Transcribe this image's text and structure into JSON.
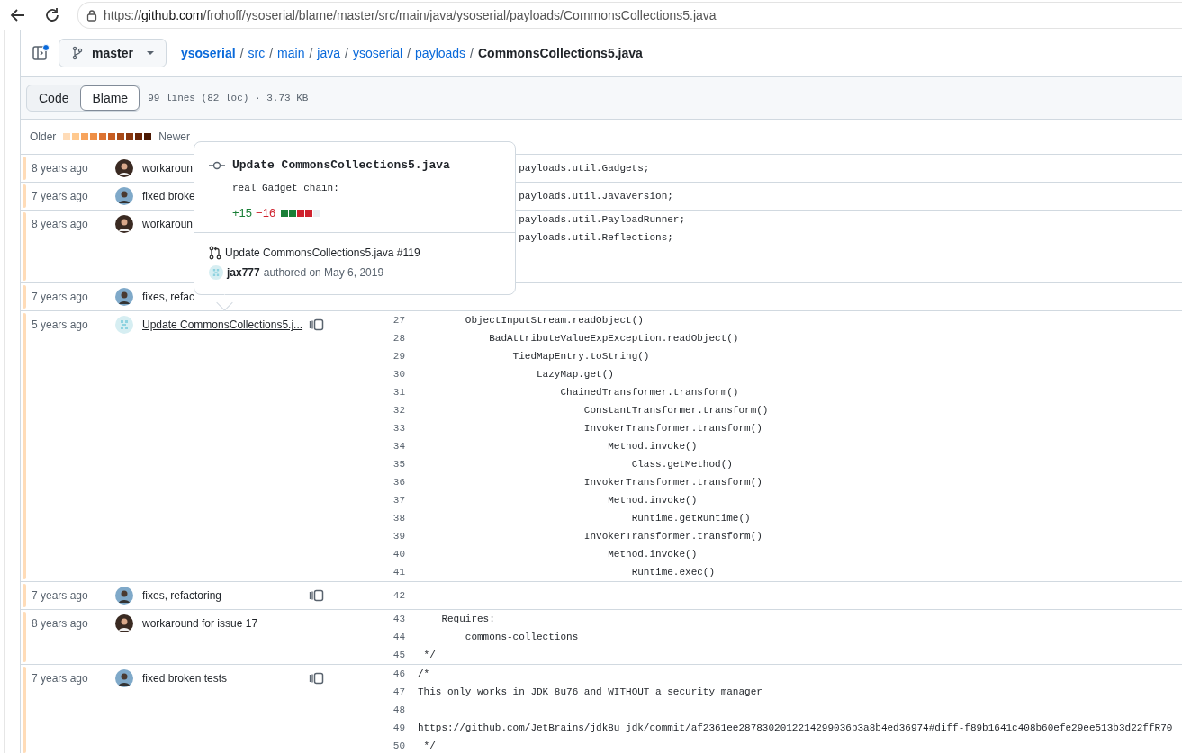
{
  "browser": {
    "url": {
      "scheme": "https://",
      "host": "github.com",
      "path": "/frohoff/ysoserial/blame/master/src/main/java/ysoserial/payloads/CommonsCollections5.java"
    }
  },
  "header": {
    "branch": "master",
    "breadcrumb": [
      {
        "label": "ysoserial",
        "kind": "repo"
      },
      {
        "label": "/",
        "kind": "separator"
      },
      {
        "label": "src",
        "kind": "dir"
      },
      {
        "label": "/",
        "kind": "separator"
      },
      {
        "label": "main",
        "kind": "dir"
      },
      {
        "label": "/",
        "kind": "separator"
      },
      {
        "label": "java",
        "kind": "dir"
      },
      {
        "label": "/",
        "kind": "separator"
      },
      {
        "label": "ysoserial",
        "kind": "dir"
      },
      {
        "label": "/",
        "kind": "separator"
      },
      {
        "label": "payloads",
        "kind": "dir"
      },
      {
        "label": "/",
        "kind": "separator"
      },
      {
        "label": "CommonsCollections5.java",
        "kind": "file"
      }
    ]
  },
  "view_tabs": [
    {
      "label": "Code",
      "selected": false
    },
    {
      "label": "Blame",
      "selected": true
    }
  ],
  "file_info": "99 lines (82 loc) · 3.73 KB",
  "legend": {
    "older": "Older",
    "newer": "Newer",
    "swatches": [
      {
        "color": "#ffdcb8"
      },
      {
        "color": "#ffc98f"
      },
      {
        "color": "#f7a45d"
      },
      {
        "color": "#ef8f45"
      },
      {
        "color": "#dd7331"
      },
      {
        "color": "#c75d22"
      },
      {
        "color": "#a84a18"
      },
      {
        "color": "#8a3810"
      },
      {
        "color": "#6a2608"
      },
      {
        "color": "#4b1903"
      }
    ]
  },
  "blame_rows": [
    {
      "age": "8 years ago",
      "avatar": {
        "kind": "dark-photo"
      },
      "message": "workaroun",
      "link": false,
      "reblame": false,
      "color": "#ffdcb8",
      "lines": [
        {
          "text": "payloads.util.Gadgets;"
        }
      ]
    },
    {
      "age": "7 years ago",
      "avatar": {
        "kind": "light-photo"
      },
      "message": "fixed broke",
      "link": false,
      "reblame": false,
      "color": "#ffdcb8",
      "lines": [
        {
          "text": "payloads.util.JavaVersion;"
        }
      ]
    },
    {
      "age": "8 years ago",
      "avatar": {
        "kind": "dark-photo"
      },
      "message": "workaroun",
      "link": false,
      "reblame": false,
      "color": "#ffdcb8",
      "lines": [
        {
          "kind": "code",
          "text": "payloads.util.PayloadRunner;"
        },
        {
          "kind": "code",
          "text": "payloads.util.Reflections;"
        },
        {
          "kind": "blank"
        },
        {
          "kind": "blank"
        }
      ]
    },
    {
      "age": "7 years ago",
      "avatar": {
        "kind": "light-photo"
      },
      "message": "fixes, refac",
      "link": false,
      "reblame": false,
      "color": "#ffdcb8"
    },
    {
      "age": "5 years ago",
      "avatar": {
        "kind": "identicon"
      },
      "message": "Update CommonsCollections5.j...",
      "link": true,
      "reblame": true,
      "color": "#ffdcb8",
      "lines": [
        {
          "number": "27",
          "text": "        ObjectInputStream.readObject()"
        },
        {
          "number": "28",
          "text": "            BadAttributeValueExpException.readObject()"
        },
        {
          "number": "29",
          "text": "                TiedMapEntry.toString()"
        },
        {
          "number": "30",
          "text": "                    LazyMap.get()"
        },
        {
          "number": "31",
          "text": "                        ChainedTransformer.transform()"
        },
        {
          "number": "32",
          "text": "                            ConstantTransformer.transform()"
        },
        {
          "number": "33",
          "text": "                            InvokerTransformer.transform()"
        },
        {
          "number": "34",
          "text": "                                Method.invoke()"
        },
        {
          "number": "35",
          "text": "                                    Class.getMethod()"
        },
        {
          "number": "36",
          "text": "                            InvokerTransformer.transform()"
        },
        {
          "number": "37",
          "text": "                                Method.invoke()"
        },
        {
          "number": "38",
          "text": "                                    Runtime.getRuntime()"
        },
        {
          "number": "39",
          "text": "                            InvokerTransformer.transform()"
        },
        {
          "number": "40",
          "text": "                                Method.invoke()"
        },
        {
          "number": "41",
          "text": "                                    Runtime.exec()"
        }
      ]
    },
    {
      "age": "7 years ago",
      "avatar": {
        "kind": "light-photo"
      },
      "message": "fixes, refactoring",
      "link": false,
      "reblame": true,
      "color": "#ffdcb8",
      "lines": [
        {
          "number": "42"
        }
      ]
    },
    {
      "age": "8 years ago",
      "avatar": {
        "kind": "dark-photo"
      },
      "message": "workaround for issue 17",
      "link": false,
      "reblame": false,
      "color": "#ffdcb8",
      "lines": [
        {
          "number": "43",
          "text": "    Requires:"
        },
        {
          "number": "44",
          "text": "        commons-collections"
        },
        {
          "number": "45",
          "text": " */"
        }
      ]
    },
    {
      "age": "7 years ago",
      "avatar": {
        "kind": "light-photo"
      },
      "message": "fixed broken tests",
      "link": false,
      "reblame": true,
      "color": "#ffdcb8",
      "lines": [
        {
          "number": "46",
          "text": "/*"
        },
        {
          "number": "47",
          "text": "This only works in JDK 8u76 and WITHOUT a security manager"
        },
        {
          "number": "48"
        },
        {
          "number": "49",
          "text": "https://github.com/JetBrains/jdk8u_jdk/commit/af2361ee2878302012214299036b3a8b4ed36974#diff-f89b1641c408b60efe29ee513b3d22ffR70"
        },
        {
          "number": "50",
          "text": " */"
        }
      ]
    }
  ],
  "popover": {
    "title": "Update CommonsCollections5.java",
    "body": "real Gadget chain:",
    "additions": "+15",
    "deletions": "−16",
    "diffstat": [
      {
        "kind": "added"
      },
      {
        "kind": "added"
      },
      {
        "kind": "deleted"
      },
      {
        "kind": "deleted"
      },
      {
        "kind": "neutral"
      }
    ],
    "pull_request": "Update CommonsCollections5.java #119",
    "author": "jax777",
    "authored": "authored on May 6, 2019"
  }
}
